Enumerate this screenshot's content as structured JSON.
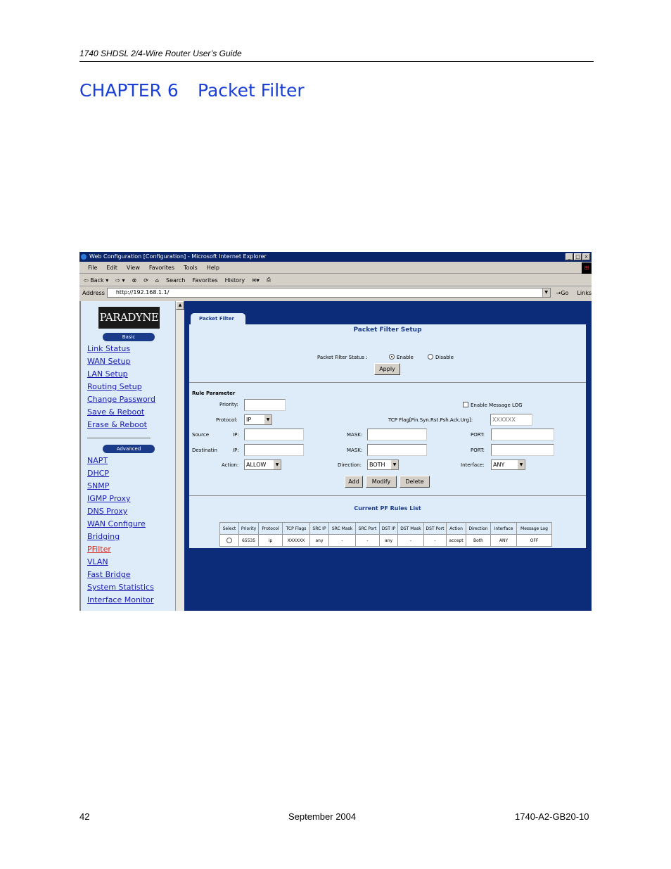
{
  "doc": {
    "header": "1740 SHDSL 2/4-Wire Router User’s Guide",
    "chapter_num": "CHAPTER 6",
    "chapter_title": "Packet Filter",
    "footer_page": "42",
    "footer_date": "September 2004",
    "footer_doc": "1740-A2-GB20-10"
  },
  "browser": {
    "title": "Web Configuration [Configuration] - Microsoft Internet Explorer",
    "menu": [
      "File",
      "Edit",
      "View",
      "Favorites",
      "Tools",
      "Help"
    ],
    "toolbar": [
      "⇦ Back ▾",
      "⇨ ▾",
      "⊗",
      "⟳",
      "⌂",
      "Search",
      "Favorites",
      "History",
      "✉▾",
      "⎙"
    ],
    "address_label": "Address",
    "address_value": "http://192.168.1.1/",
    "go_label": "Go",
    "links_label": "Links"
  },
  "nav": {
    "logo": "PARADYNE",
    "basic_label": "Basic",
    "basic_items": [
      "Link Status",
      "WAN Setup",
      "LAN Setup",
      "Routing Setup",
      "Change Password",
      "Save & Reboot",
      "Erase & Reboot"
    ],
    "advanced_label": "Advanced",
    "advanced_items": [
      "NAPT",
      "DHCP",
      "SNMP",
      "IGMP Proxy",
      "DNS Proxy",
      "WAN Configure",
      "Bridging",
      "PFilter",
      "VLAN",
      "Fast Bridge",
      "System Statistics",
      "Interface Monitor"
    ]
  },
  "form": {
    "tab_label": "Packet Filter",
    "setup_title": "Packet Filter Setup",
    "status_label": "Packet Filter Status :",
    "enable_label": "Enable",
    "disable_label": "Disable",
    "apply_label": "Apply",
    "rule_param_label": "Rule Parameter",
    "priority_label": "Priority:",
    "priority_value": "",
    "log_label": "Enable Message LOG",
    "protocol_label": "Protocol:",
    "protocol_value": "IP",
    "tcp_flag_label": "TCP Flag[Fin.Syn.Rst.Psh.Ack.Urg]:",
    "tcp_flag_value": "XXXXXX",
    "source_label": "Source",
    "ip_label": "IP:",
    "mask_label": "MASK:",
    "port_label": "PORT:",
    "dest_label": "Destinatin",
    "action_label": "Action:",
    "action_value": "ALLOW",
    "direction_label": "Direction:",
    "direction_value": "BOTH",
    "interface_label": "Interface:",
    "interface_value": "ANY",
    "add_label": "Add",
    "modify_label": "Modify",
    "delete_label": "Delete",
    "list_title": "Current PF Rules List",
    "table_headers": [
      "Select",
      "Priority",
      "Protocol",
      "TCP Flags",
      "SRC IP",
      "SRC Mask",
      "SRC Port",
      "DST IP",
      "DST Mask",
      "DST Port",
      "Action",
      "Direction",
      "Interface",
      "Message Log"
    ],
    "table_row": [
      "",
      "65535",
      "ip",
      "XXXXXX",
      "any",
      "-",
      "-",
      "any",
      "-",
      "-",
      "accept",
      "Both",
      "ANY",
      "OFF"
    ]
  }
}
